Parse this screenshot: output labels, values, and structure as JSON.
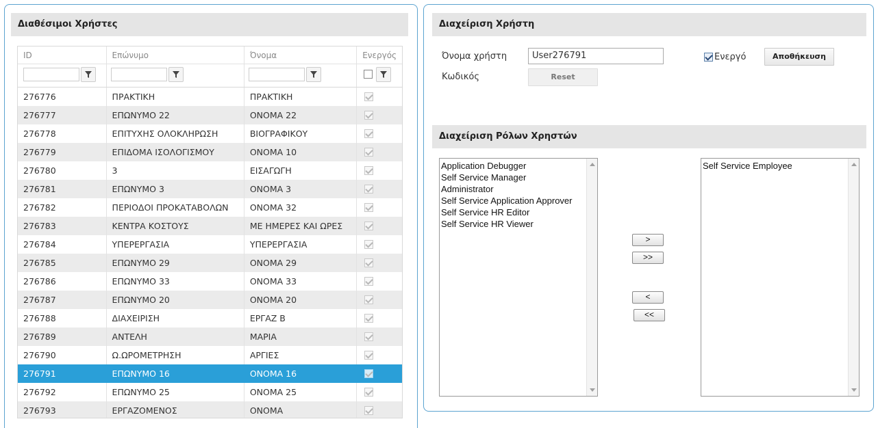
{
  "left": {
    "title": "Διαθέσιμοι Χρήστες",
    "columns": [
      "ID",
      "Επώνυμο",
      "Όνομα",
      "Ενεργός"
    ],
    "rows": [
      {
        "id": "276776",
        "surname": "ΠΡΑΚΤΙΚΗ",
        "name": "ΠΡΑΚΤΙΚΗ",
        "active": true
      },
      {
        "id": "276777",
        "surname": "ΕΠΩΝΥΜΟ 22",
        "name": "ΟΝΟΜΑ 22",
        "active": true
      },
      {
        "id": "276778",
        "surname": "ΕΠΙΤΥΧΗΣ ΟΛΟΚΛΗΡΩΣΗ",
        "name": "ΒΙΟΓΡΑΦΙΚΟΥ",
        "active": true
      },
      {
        "id": "276779",
        "surname": "ΕΠΙΔΟΜΑ ΙΣΟΛΟΓΙΣΜΟΥ",
        "name": "ΟΝΟΜΑ 10",
        "active": true
      },
      {
        "id": "276780",
        "surname": "3",
        "name": "ΕΙΣΑΓΩΓΗ",
        "active": true
      },
      {
        "id": "276781",
        "surname": "ΕΠΩΝΥΜΟ 3",
        "name": "ΟΝΟΜΑ 3",
        "active": true
      },
      {
        "id": "276782",
        "surname": "ΠΕΡΙΟΔΟΙ ΠΡΟΚΑΤΑΒΟΛΩΝ",
        "name": "ΟΝΟΜΑ 32",
        "active": true
      },
      {
        "id": "276783",
        "surname": "ΚΕΝΤΡΑ ΚΟΣΤΟΥΣ",
        "name": "ΜΕ ΗΜΕΡΕΣ ΚΑΙ ΩΡΕΣ",
        "active": true
      },
      {
        "id": "276784",
        "surname": "ΥΠΕΡΕΡΓΑΣΙΑ",
        "name": "ΥΠΕΡΕΡΓΑΣΙΑ",
        "active": true
      },
      {
        "id": "276785",
        "surname": "ΕΠΩΝΥΜΟ 29",
        "name": "ΟΝΟΜΑ 29",
        "active": true
      },
      {
        "id": "276786",
        "surname": "ΕΠΩΝΥΜΟ 33",
        "name": "ΟΝΟΜΑ 33",
        "active": true
      },
      {
        "id": "276787",
        "surname": "ΕΠΩΝΥΜΟ 20",
        "name": "ΟΝΟΜΑ 20",
        "active": true
      },
      {
        "id": "276788",
        "surname": "ΔΙΑΧΕΙΡΙΣΗ",
        "name": "ΕΡΓΑΖ Β",
        "active": true
      },
      {
        "id": "276789",
        "surname": "ΑΝΤΕΛΗ",
        "name": "ΜΑΡΙΑ",
        "active": true
      },
      {
        "id": "276790",
        "surname": "Ω.ΩΡΟΜΕΤΡΗΣΗ",
        "name": "ΑΡΓΙΕΣ",
        "active": true
      },
      {
        "id": "276791",
        "surname": "ΕΠΩΝΥΜΟ 16",
        "name": "ΟΝΟΜΑ 16",
        "active": true,
        "selected": true
      },
      {
        "id": "276792",
        "surname": "ΕΠΩΝΥΜΟ 25",
        "name": "ΟΝΟΜΑ 25",
        "active": true
      },
      {
        "id": "276793",
        "surname": "ΕΡΓΑΖΟΜΕΝΟΣ",
        "name": "ΟΝΟΜΑ",
        "active": true
      }
    ]
  },
  "user": {
    "title": "Διαχείριση Χρήστη",
    "username_label": "Όνομα χρήστη",
    "username_value": "User276791",
    "password_label": "Κωδικός",
    "reset_label": "Reset",
    "active_label": "Ενεργό",
    "save_label": "Αποθήκευση"
  },
  "roles": {
    "title": "Διαχείριση Ρόλων Χρηστών",
    "available": [
      "Application Debugger",
      "Self Service Manager",
      "Administrator",
      "Self Service Application Approver",
      "Self Service HR Editor",
      "Self Service HR Viewer"
    ],
    "assigned": [
      "Self Service Employee"
    ],
    "move_right": ">",
    "move_all_right": ">>",
    "move_left": "<",
    "move_all_left": "<<"
  },
  "colors": {
    "panel_border": "#5ba3d0",
    "selected_row": "#2a9fd8",
    "header_bg": "#e5e5e5"
  }
}
